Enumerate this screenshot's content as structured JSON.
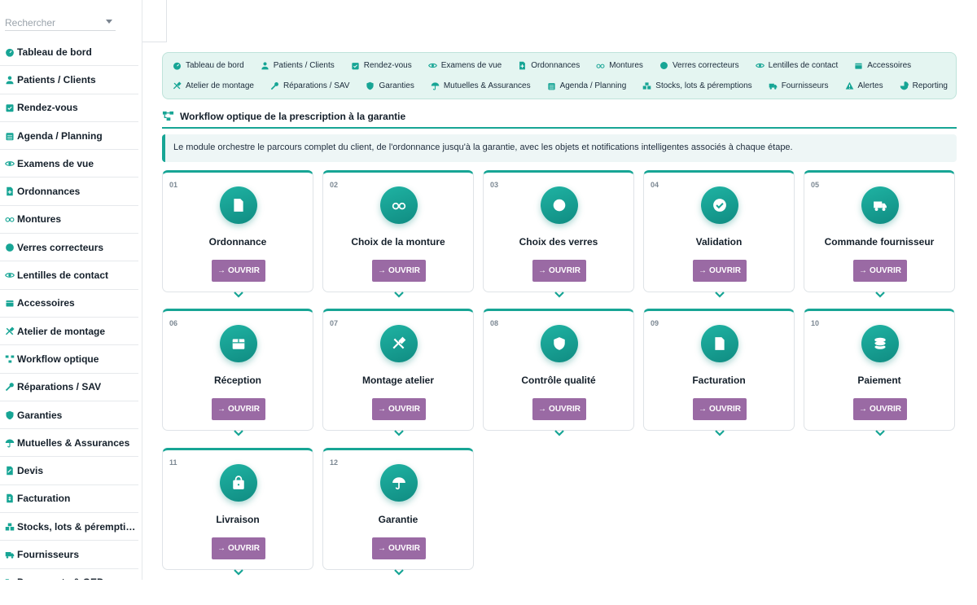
{
  "search": {
    "placeholder": "Rechercher"
  },
  "sidebar": {
    "items": [
      {
        "label": "Tableau de bord",
        "icon": "gauge-icon"
      },
      {
        "label": "Patients / Clients",
        "icon": "user-icon"
      },
      {
        "label": "Rendez-vous",
        "icon": "calendar-check-icon"
      },
      {
        "label": "Agenda / Planning",
        "icon": "calendar-icon"
      },
      {
        "label": "Examens de vue",
        "icon": "eye-icon"
      },
      {
        "label": "Ordonnances",
        "icon": "file-prescription-icon"
      },
      {
        "label": "Montures",
        "icon": "glasses-icon"
      },
      {
        "label": "Verres correcteurs",
        "icon": "circle-icon"
      },
      {
        "label": "Lentilles de contact",
        "icon": "eye-icon"
      },
      {
        "label": "Accessoires",
        "icon": "box-icon"
      },
      {
        "label": "Atelier de montage",
        "icon": "tools-icon"
      },
      {
        "label": "Workflow optique",
        "icon": "workflow-icon"
      },
      {
        "label": "Réparations / SAV",
        "icon": "wrench-icon"
      },
      {
        "label": "Garanties",
        "icon": "shield-icon"
      },
      {
        "label": "Mutuelles & Assurances",
        "icon": "umbrella-icon"
      },
      {
        "label": "Devis",
        "icon": "file-edit-icon"
      },
      {
        "label": "Facturation",
        "icon": "invoice-icon"
      },
      {
        "label": "Stocks, lots & péremptions",
        "icon": "boxes-icon"
      },
      {
        "label": "Fournisseurs",
        "icon": "truck-icon"
      },
      {
        "label": "Documents & GED",
        "icon": "folder-icon"
      }
    ]
  },
  "topmenu": {
    "row1": [
      {
        "label": "Tableau de bord",
        "icon": "gauge-icon"
      },
      {
        "label": "Patients / Clients",
        "icon": "user-icon"
      },
      {
        "label": "Rendez-vous",
        "icon": "calendar-check-icon"
      },
      {
        "label": "Examens de vue",
        "icon": "eye-icon"
      },
      {
        "label": "Ordonnances",
        "icon": "file-prescription-icon"
      },
      {
        "label": "Montures",
        "icon": "glasses-icon"
      },
      {
        "label": "Verres correcteurs",
        "icon": "circle-icon"
      },
      {
        "label": "Lentilles de contact",
        "icon": "eye-icon"
      },
      {
        "label": "Accessoires",
        "icon": "box-icon"
      }
    ],
    "row2": [
      {
        "label": "Atelier de montage",
        "icon": "tools-icon"
      },
      {
        "label": "Réparations / SAV",
        "icon": "wrench-icon"
      },
      {
        "label": "Garanties",
        "icon": "shield-icon"
      },
      {
        "label": "Mutuelles & Assurances",
        "icon": "umbrella-icon"
      },
      {
        "label": "Agenda / Planning",
        "icon": "calendar-icon"
      },
      {
        "label": "Stocks, lots & péremptions",
        "icon": "boxes-icon"
      },
      {
        "label": "Fournisseurs",
        "icon": "truck-icon"
      },
      {
        "label": "Alertes",
        "icon": "warning-icon"
      },
      {
        "label": "Reporting",
        "icon": "pie-chart-icon"
      }
    ]
  },
  "section": {
    "title": "Workflow optique de la prescription à la garantie",
    "info": "Le module orchestre le parcours complet du client, de l'ordonnance jusqu'à la garantie, avec les objets et notifications intelligentes associés à chaque étape."
  },
  "steps": [
    {
      "num": "01",
      "title": "Ordonnance",
      "button": "OUVRIR",
      "icon": "file-prescription-icon"
    },
    {
      "num": "02",
      "title": "Choix de la monture",
      "button": "OUVRIR",
      "icon": "glasses-icon"
    },
    {
      "num": "03",
      "title": "Choix des verres",
      "button": "OUVRIR",
      "icon": "circle-icon"
    },
    {
      "num": "04",
      "title": "Validation",
      "button": "OUVRIR",
      "icon": "check-circle-icon"
    },
    {
      "num": "05",
      "title": "Commande fournisseur",
      "button": "OUVRIR",
      "icon": "truck-icon"
    },
    {
      "num": "06",
      "title": "Réception",
      "button": "OUVRIR",
      "icon": "box-open-icon"
    },
    {
      "num": "07",
      "title": "Montage atelier",
      "button": "OUVRIR",
      "icon": "tools-icon"
    },
    {
      "num": "08",
      "title": "Contrôle qualité",
      "button": "OUVRIR",
      "icon": "shield-icon"
    },
    {
      "num": "09",
      "title": "Facturation",
      "button": "OUVRIR",
      "icon": "invoice-icon"
    },
    {
      "num": "10",
      "title": "Paiement",
      "button": "OUVRIR",
      "icon": "coins-icon"
    },
    {
      "num": "11",
      "title": "Livraison",
      "button": "OUVRIR",
      "icon": "shopping-bag-icon"
    },
    {
      "num": "12",
      "title": "Garantie",
      "button": "OUVRIR",
      "icon": "umbrella-icon"
    }
  ],
  "colors": {
    "accent": "#17a595",
    "button": "#9a6aa4",
    "menu_bg": "#e4f5f1"
  }
}
